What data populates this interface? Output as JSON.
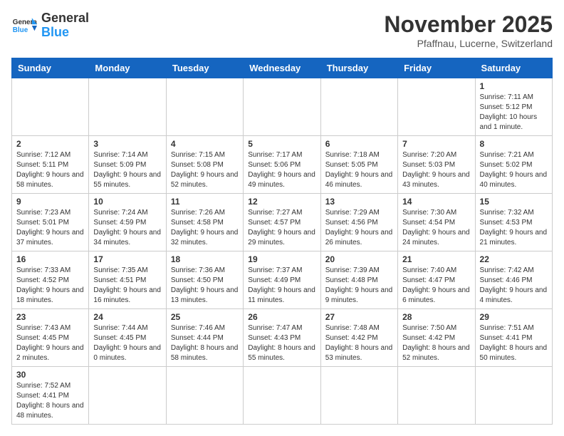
{
  "header": {
    "logo_general": "General",
    "logo_blue": "Blue",
    "month_title": "November 2025",
    "location": "Pfaffnau, Lucerne, Switzerland"
  },
  "weekdays": [
    "Sunday",
    "Monday",
    "Tuesday",
    "Wednesday",
    "Thursday",
    "Friday",
    "Saturday"
  ],
  "weeks": [
    [
      {
        "day": "",
        "info": ""
      },
      {
        "day": "",
        "info": ""
      },
      {
        "day": "",
        "info": ""
      },
      {
        "day": "",
        "info": ""
      },
      {
        "day": "",
        "info": ""
      },
      {
        "day": "",
        "info": ""
      },
      {
        "day": "1",
        "info": "Sunrise: 7:11 AM\nSunset: 5:12 PM\nDaylight: 10 hours and 1 minute."
      }
    ],
    [
      {
        "day": "2",
        "info": "Sunrise: 7:12 AM\nSunset: 5:11 PM\nDaylight: 9 hours and 58 minutes."
      },
      {
        "day": "3",
        "info": "Sunrise: 7:14 AM\nSunset: 5:09 PM\nDaylight: 9 hours and 55 minutes."
      },
      {
        "day": "4",
        "info": "Sunrise: 7:15 AM\nSunset: 5:08 PM\nDaylight: 9 hours and 52 minutes."
      },
      {
        "day": "5",
        "info": "Sunrise: 7:17 AM\nSunset: 5:06 PM\nDaylight: 9 hours and 49 minutes."
      },
      {
        "day": "6",
        "info": "Sunrise: 7:18 AM\nSunset: 5:05 PM\nDaylight: 9 hours and 46 minutes."
      },
      {
        "day": "7",
        "info": "Sunrise: 7:20 AM\nSunset: 5:03 PM\nDaylight: 9 hours and 43 minutes."
      },
      {
        "day": "8",
        "info": "Sunrise: 7:21 AM\nSunset: 5:02 PM\nDaylight: 9 hours and 40 minutes."
      }
    ],
    [
      {
        "day": "9",
        "info": "Sunrise: 7:23 AM\nSunset: 5:01 PM\nDaylight: 9 hours and 37 minutes."
      },
      {
        "day": "10",
        "info": "Sunrise: 7:24 AM\nSunset: 4:59 PM\nDaylight: 9 hours and 34 minutes."
      },
      {
        "day": "11",
        "info": "Sunrise: 7:26 AM\nSunset: 4:58 PM\nDaylight: 9 hours and 32 minutes."
      },
      {
        "day": "12",
        "info": "Sunrise: 7:27 AM\nSunset: 4:57 PM\nDaylight: 9 hours and 29 minutes."
      },
      {
        "day": "13",
        "info": "Sunrise: 7:29 AM\nSunset: 4:56 PM\nDaylight: 9 hours and 26 minutes."
      },
      {
        "day": "14",
        "info": "Sunrise: 7:30 AM\nSunset: 4:54 PM\nDaylight: 9 hours and 24 minutes."
      },
      {
        "day": "15",
        "info": "Sunrise: 7:32 AM\nSunset: 4:53 PM\nDaylight: 9 hours and 21 minutes."
      }
    ],
    [
      {
        "day": "16",
        "info": "Sunrise: 7:33 AM\nSunset: 4:52 PM\nDaylight: 9 hours and 18 minutes."
      },
      {
        "day": "17",
        "info": "Sunrise: 7:35 AM\nSunset: 4:51 PM\nDaylight: 9 hours and 16 minutes."
      },
      {
        "day": "18",
        "info": "Sunrise: 7:36 AM\nSunset: 4:50 PM\nDaylight: 9 hours and 13 minutes."
      },
      {
        "day": "19",
        "info": "Sunrise: 7:37 AM\nSunset: 4:49 PM\nDaylight: 9 hours and 11 minutes."
      },
      {
        "day": "20",
        "info": "Sunrise: 7:39 AM\nSunset: 4:48 PM\nDaylight: 9 hours and 9 minutes."
      },
      {
        "day": "21",
        "info": "Sunrise: 7:40 AM\nSunset: 4:47 PM\nDaylight: 9 hours and 6 minutes."
      },
      {
        "day": "22",
        "info": "Sunrise: 7:42 AM\nSunset: 4:46 PM\nDaylight: 9 hours and 4 minutes."
      }
    ],
    [
      {
        "day": "23",
        "info": "Sunrise: 7:43 AM\nSunset: 4:45 PM\nDaylight: 9 hours and 2 minutes."
      },
      {
        "day": "24",
        "info": "Sunrise: 7:44 AM\nSunset: 4:45 PM\nDaylight: 9 hours and 0 minutes."
      },
      {
        "day": "25",
        "info": "Sunrise: 7:46 AM\nSunset: 4:44 PM\nDaylight: 8 hours and 58 minutes."
      },
      {
        "day": "26",
        "info": "Sunrise: 7:47 AM\nSunset: 4:43 PM\nDaylight: 8 hours and 55 minutes."
      },
      {
        "day": "27",
        "info": "Sunrise: 7:48 AM\nSunset: 4:42 PM\nDaylight: 8 hours and 53 minutes."
      },
      {
        "day": "28",
        "info": "Sunrise: 7:50 AM\nSunset: 4:42 PM\nDaylight: 8 hours and 52 minutes."
      },
      {
        "day": "29",
        "info": "Sunrise: 7:51 AM\nSunset: 4:41 PM\nDaylight: 8 hours and 50 minutes."
      }
    ],
    [
      {
        "day": "30",
        "info": "Sunrise: 7:52 AM\nSunset: 4:41 PM\nDaylight: 8 hours and 48 minutes."
      },
      {
        "day": "",
        "info": ""
      },
      {
        "day": "",
        "info": ""
      },
      {
        "day": "",
        "info": ""
      },
      {
        "day": "",
        "info": ""
      },
      {
        "day": "",
        "info": ""
      },
      {
        "day": "",
        "info": ""
      }
    ]
  ]
}
